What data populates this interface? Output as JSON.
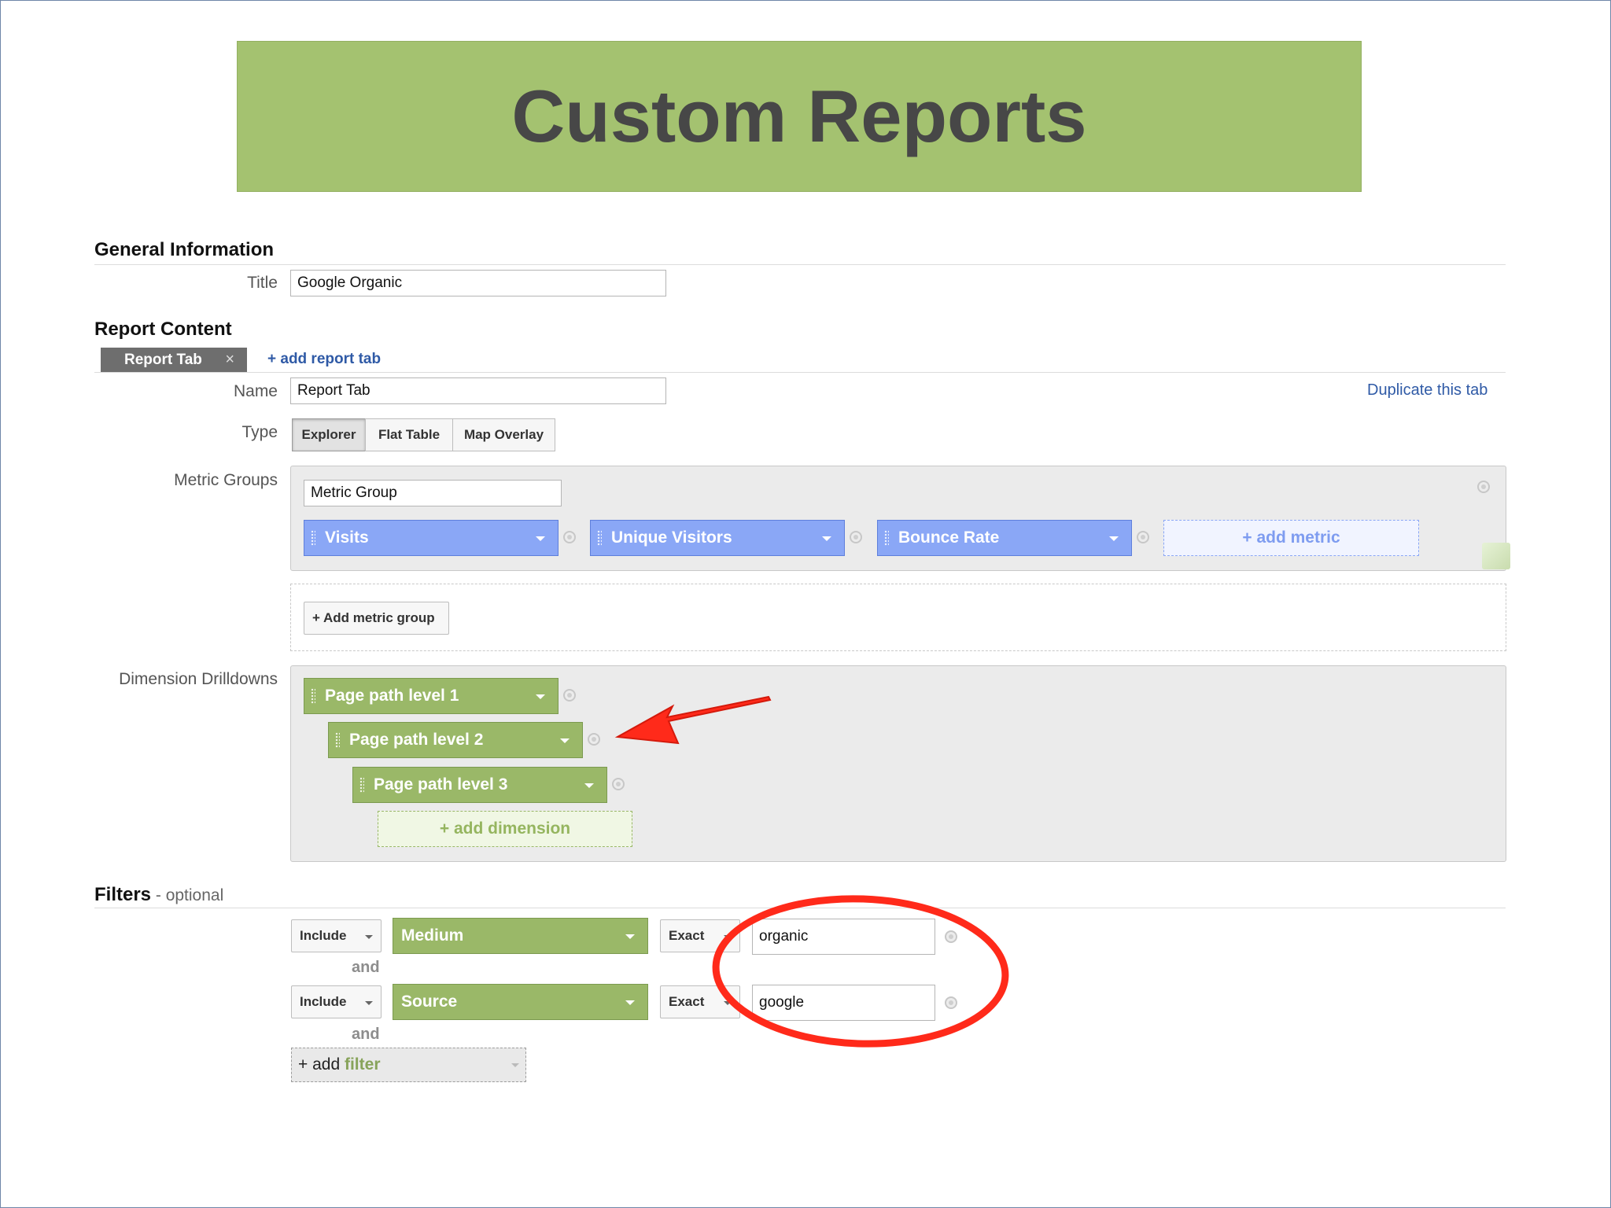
{
  "banner": {
    "title": "Custom Reports"
  },
  "general": {
    "heading": "General Information",
    "title_label": "Title",
    "title_value": "Google Organic"
  },
  "content": {
    "heading": "Report Content",
    "tab_label": "Report Tab",
    "tab_close": "×",
    "add_tab": "+ add report tab",
    "name_label": "Name",
    "name_value": "Report Tab",
    "duplicate": "Duplicate this tab",
    "type_label": "Type",
    "types": [
      "Explorer",
      "Flat Table",
      "Map Overlay"
    ],
    "selected_type": "Explorer",
    "metric_groups_label": "Metric Groups",
    "metric_group_name": "Metric Group",
    "metrics": [
      "Visits",
      "Unique Visitors",
      "Bounce Rate"
    ],
    "add_metric": "+ add metric",
    "add_metric_group": "+ Add metric group",
    "dimension_label": "Dimension Drilldowns",
    "dimensions": [
      "Page path level 1",
      "Page path level 2",
      "Page path level 3"
    ],
    "add_dimension": "+ add dimension"
  },
  "filters": {
    "heading": "Filters",
    "optional": " - optional",
    "rows": [
      {
        "mode": "Include",
        "dimension": "Medium",
        "match": "Exact",
        "value": "organic"
      },
      {
        "mode": "Include",
        "dimension": "Source",
        "match": "Exact",
        "value": "google"
      }
    ],
    "and_label": "and",
    "add_prefix": "+ add ",
    "add_word": "filter"
  },
  "colors": {
    "banner": "#a4c270",
    "metric_pill": "#8aa7f6",
    "dimension_pill": "#9ab868",
    "annotation": "#ff2a1a"
  },
  "icons": [
    "drag-handle-icon",
    "dropdown-caret-icon",
    "remove-circle-icon",
    "close-icon"
  ]
}
